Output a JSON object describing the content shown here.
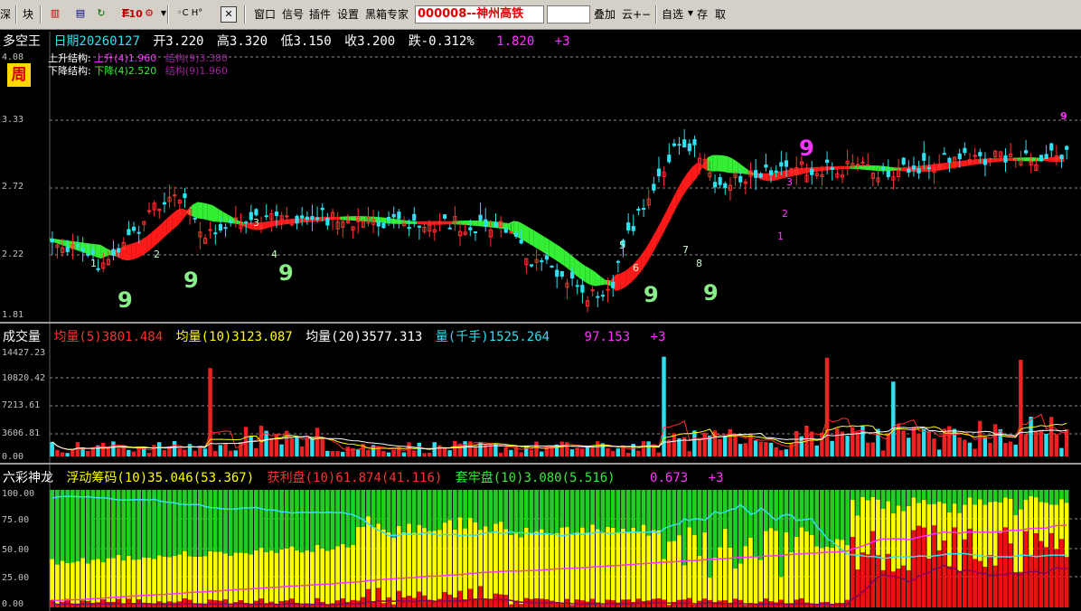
{
  "toolbar": {
    "btn_shen": "深",
    "btn_kuai": "块",
    "btn_window": "窗口",
    "btn_signal": "信号",
    "btn_plugin": "插件",
    "btn_settings": "设置",
    "btn_blackbox": "黑箱专家",
    "stock": "000008--神州高铁",
    "btn_overlay": "叠加",
    "btn_cloud": "云+−",
    "btn_selfselect": "自选",
    "btn_save": "存",
    "btn_fetch": "取",
    "f10_label": "F10"
  },
  "main_header": {
    "indicator": "多空王",
    "date": "日期20260127",
    "open": "开3.220",
    "high": "高3.320",
    "low": "低3.150",
    "close": "收3.200",
    "change": "跌-0.312%",
    "value": "1.820",
    "plus": "+3"
  },
  "period_badge": "周",
  "structure": {
    "up_label": "上升结构:",
    "up_a": "上升(4)1.960",
    "up_b": "结构(9)3.380",
    "down_label": "下降结构:",
    "down_a": "下降(4)2.520",
    "down_b": "结构(9)1.960"
  },
  "price_axis": [
    "4.08",
    "3.33",
    "2.72",
    "2.22",
    "1.81"
  ],
  "volume_header": {
    "title": "成交量",
    "ma5": "均量(5)3801.484",
    "ma10": "均量(10)3123.087",
    "ma20": "均量(20)3577.313",
    "vol": "量(千手)1525.264",
    "value": "97.153",
    "plus": "+3"
  },
  "volume_axis": [
    "14427.23",
    "10820.42",
    "7213.61",
    "3606.81",
    "0.00"
  ],
  "chip_header": {
    "title": "六彩神龙",
    "floating": "浮动筹码(10)35.046(53.367)",
    "profit": "获利盘(10)61.874(41.116)",
    "trapped": "套牢盘(10)3.080(5.516)",
    "value": "0.673",
    "plus": "+3"
  },
  "chip_axis": [
    "100.00",
    "75.00",
    "50.00",
    "25.00",
    "0.00"
  ],
  "colors": {
    "up": "#ff3030",
    "down": "#30e0f0",
    "ribbon_up": "#ff1a1a",
    "ribbon_down": "#33ee33",
    "grid": "#8a8a8a",
    "white": "#ffffff",
    "yellow": "#ffff00",
    "magenta": "#ff00ff",
    "green_chip": "#22cc22"
  },
  "signals": {
    "nine_markers": [
      "9",
      "9",
      "9",
      "9",
      "9",
      "9",
      "9"
    ],
    "sequence_labels": [
      "1",
      "2",
      "3",
      "4",
      "5",
      "6",
      "7",
      "8"
    ]
  }
}
